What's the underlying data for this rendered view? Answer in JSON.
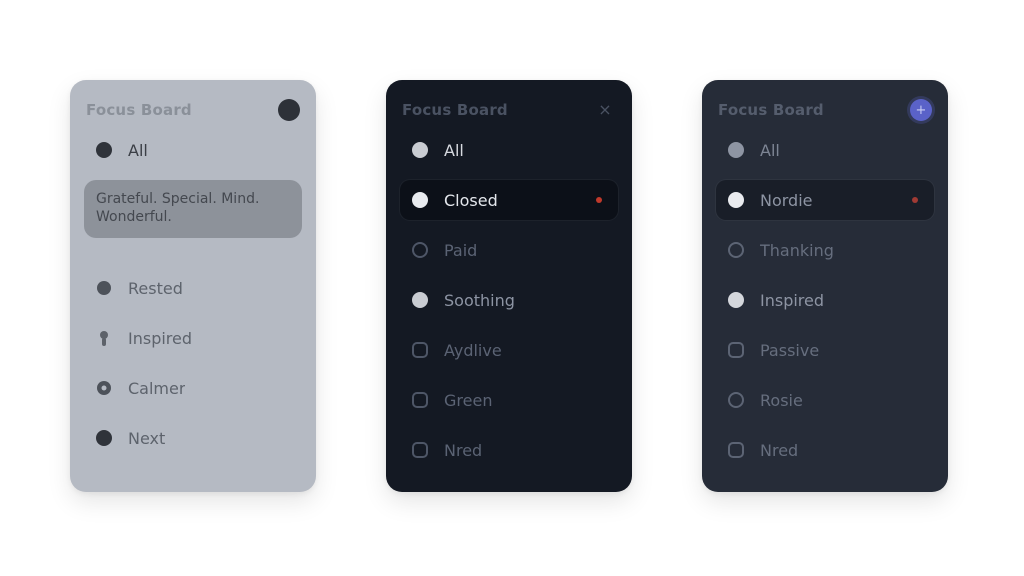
{
  "colors": {
    "light_panel": "#b5bac3",
    "dark_panel_1": "#141923",
    "dark_panel_2": "#262c38",
    "accent_blue": "#5a62c8",
    "alert_red": "#c0392b"
  },
  "panels": [
    {
      "title": "Focus Board",
      "header_icon": "dot-icon",
      "items": [
        {
          "label": "All",
          "icon": "disc-icon"
        },
        {
          "label": "Rested",
          "icon": "disc-icon"
        },
        {
          "label": "Inspired",
          "icon": "pin-icon"
        },
        {
          "label": "Calmer",
          "icon": "gear-icon"
        },
        {
          "label": "Next",
          "icon": "disc-icon"
        }
      ],
      "card_text": "Grateful. Special. Mind. Wonderful."
    },
    {
      "title": "Focus Board",
      "header_icon": "close-icon",
      "header_symbol": "×",
      "items": [
        {
          "label": "All",
          "icon": "disc-icon"
        },
        {
          "label": "Closed",
          "icon": "disc-icon",
          "selected": true
        },
        {
          "label": "Paid",
          "icon": "ring-icon"
        },
        {
          "label": "Soothing",
          "icon": "disc-icon"
        },
        {
          "label": "Aydlive",
          "icon": "square-icon"
        },
        {
          "label": "Green",
          "icon": "square-icon"
        },
        {
          "label": "Nred",
          "icon": "square-icon"
        }
      ]
    },
    {
      "title": "Focus Board",
      "header_icon": "plus-icon",
      "header_symbol": "+",
      "items": [
        {
          "label": "All",
          "icon": "disc-icon"
        },
        {
          "label": "Nordie",
          "icon": "disc-icon",
          "selected": true
        },
        {
          "label": "Thanking",
          "icon": "ring-icon"
        },
        {
          "label": "Inspired",
          "icon": "disc-icon"
        },
        {
          "label": "Passive",
          "icon": "square-icon"
        },
        {
          "label": "Rosie",
          "icon": "ring-icon"
        },
        {
          "label": "Nred",
          "icon": "square-icon"
        }
      ]
    }
  ]
}
